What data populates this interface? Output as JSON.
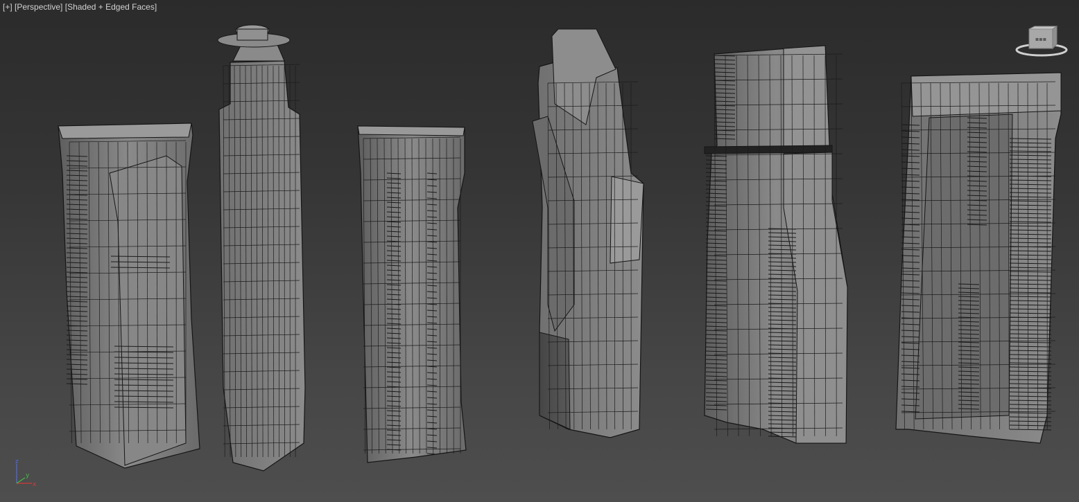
{
  "viewport": {
    "label_plus": "[+]",
    "label_view": "[Perspective]",
    "label_shading": "[Shaded + Edged Faces]"
  },
  "axis_tripod": {
    "x": "x",
    "y": "y",
    "z": "z",
    "colors": {
      "x": "#d23a3a",
      "y": "#3fbf3f",
      "z": "#4c6cf0"
    }
  },
  "viewcube": {
    "icon": "viewcube-icon"
  },
  "colors": {
    "background_top": "#2b2b2b",
    "background_bottom": "#4e4e4e",
    "mesh_fill": "#7d7d7d",
    "wire": "#151515"
  }
}
